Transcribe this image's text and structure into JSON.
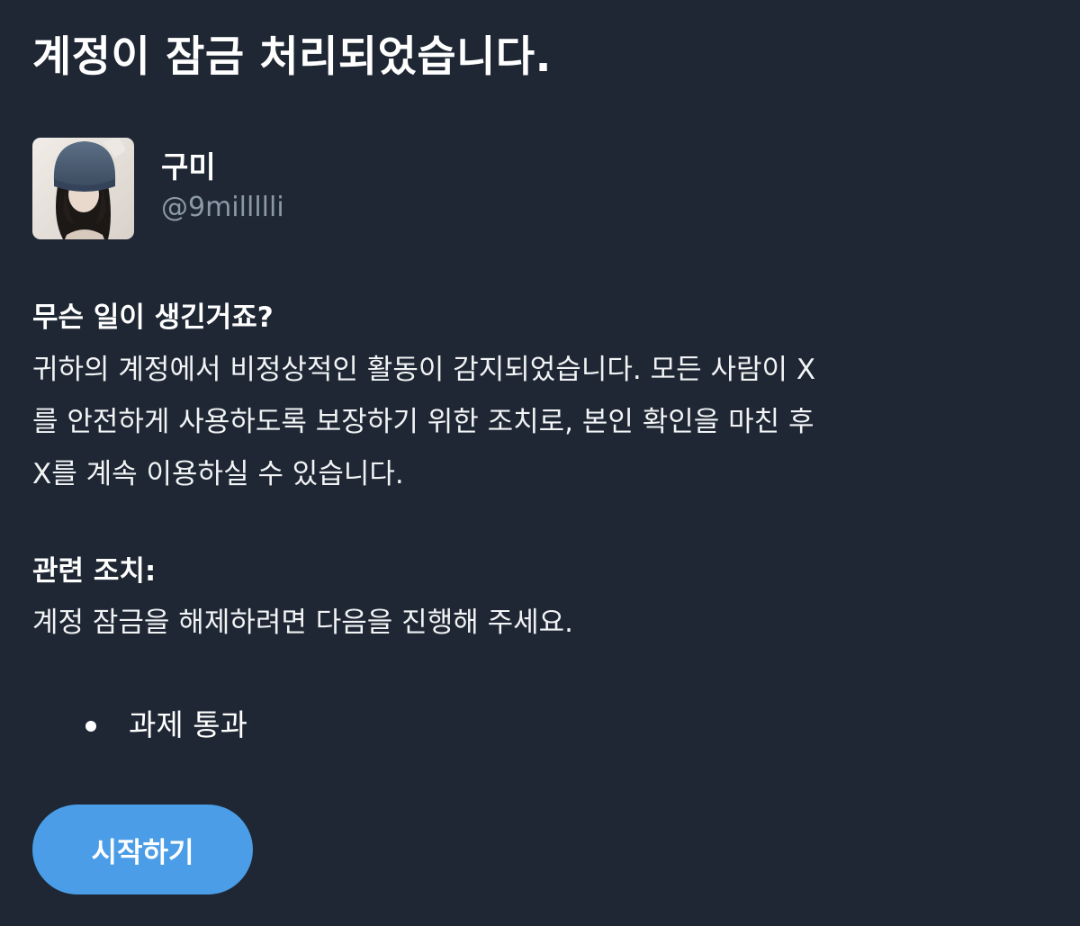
{
  "header": {
    "title": "계정이 잠금 처리되었습니다."
  },
  "profile": {
    "display_name": "구미",
    "handle": "@9millllli"
  },
  "what_happened": {
    "heading": "무슨 일이 생긴거죠?",
    "lines": [
      "귀하의 계정에서 비정상적인 활동이 감지되었습니다. 모든 사람이 X",
      "를 안전하게 사용하도록 보장하기 위한 조치로, 본인 확인을 마친 후",
      "X를 계속 이용하실 수 있습니다."
    ]
  },
  "related_action": {
    "heading": "관련 조치:",
    "body": "계정 잠금을 해제하려면 다음을 진행해 주세요.",
    "tasks": [
      "과제 통과"
    ]
  },
  "start_button": {
    "label": "시작하기"
  },
  "colors": {
    "background": "#1e2733",
    "text": "#ffffff",
    "secondary_text": "#8b98a5",
    "button": "#4a9de6"
  }
}
